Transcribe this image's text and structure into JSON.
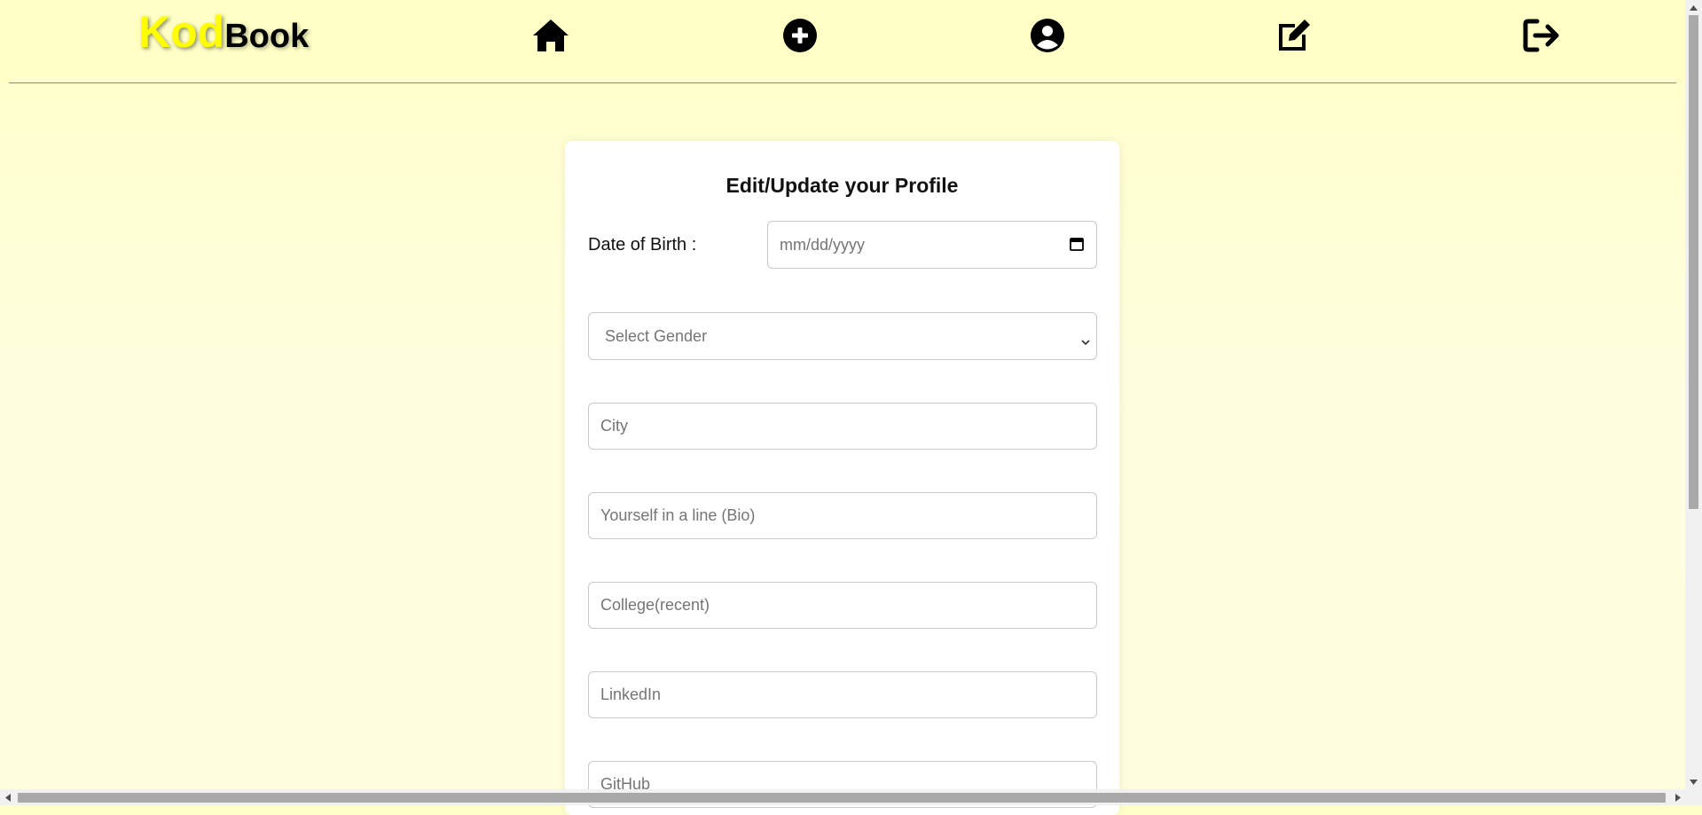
{
  "brand": {
    "logo_part1": "Kod",
    "logo_part2": "Book"
  },
  "nav": {
    "icons": [
      "home-icon",
      "add-circle-icon",
      "user-circle-icon",
      "edit-icon",
      "logout-icon"
    ]
  },
  "form": {
    "title": "Edit/Update your Profile",
    "dob_label": "Date of Birth :",
    "dob_placeholder": "mm/dd/yyyy",
    "gender_selected": "Select Gender",
    "city_placeholder": "City",
    "bio_placeholder": "Yourself in a line (Bio)",
    "college_placeholder": "College(recent)",
    "linkedin_placeholder": "LinkedIn",
    "github_placeholder": "GitHub"
  },
  "colors": {
    "background": "#ffffdd",
    "navbar": "#ffffc6",
    "logo_accent": "#ffff00"
  }
}
